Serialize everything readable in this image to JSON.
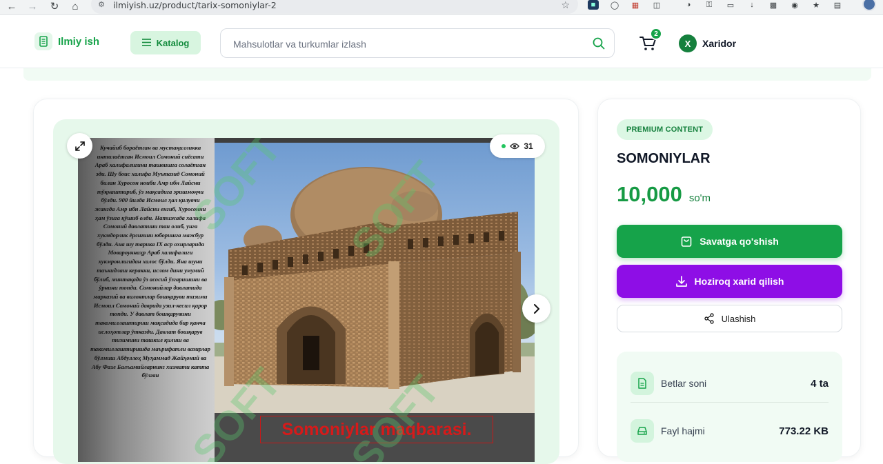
{
  "browser": {
    "url": "ilmiyish.uz/product/tarix-somoniylar-2"
  },
  "header": {
    "logo_text": "Ilmiy ish",
    "catalog_label": "Katalog",
    "search_placeholder": "Mahsulotlar va turkumlar izlash",
    "cart_count": "2",
    "user_initial": "X",
    "user_name": "Xaridor"
  },
  "gallery": {
    "views": "31",
    "caption": "Somoniylar maqbarasi.",
    "watermark": "SOFT",
    "slide_text": "Кучайиб бораётган ва мустақилликка интилаётган Исмоил Сомоний сиёсати Араб халифалигини ташвишга солаётган эди. Шу боис халифа Муътазид Сомоний билан Хуросон ноиби Амр ибн Лайсни тўқнаштириб, ўз мақсадига эришмоқчи бўлди. 900 йилда Исмоил ҳал қилувчи жангда Амр ибн Лайсни енгиб, Хуросонни ҳам ўзига қўшиб олди. Натижада халифа Сомоний давлатини тан олиб, унга хукмдорлик ёрлиғини юборишга мажбур бўлди. Ана шу тарика IX аср охирларида Мовароуннаҳр Араб халифалиги хукмронлигидан халос бўлди. Яна шуни таъкидлаш керакки, ислом дини умумий бўлиб, минтақада ўз асосий ўзгаришини ва ўрнини топди. Сомонийлар давлатида марказий ва вилоятлар бошқаруви тизими Исмоил Сомоний даврида узил-кесил қарор топди. У давлат бошқарувини такомиллаштириш мақсадида бир қанча ислоҳотлар ўтказди. Давлат бошқарув тизимини ташкил қилиш ва такомиллаштиришда маърифатли вазирлар бўлмиш Абдуллоҳ Муҳаммад Жайҳоний ва Абу Фазл Балъамийларнинг хизмати катта бўлган"
  },
  "product": {
    "badge": "PREMIUM CONTENT",
    "title": "SOMONIYLAR",
    "price": "10,000",
    "currency": "so'm",
    "add_to_cart": "Savatga qo'shish",
    "buy_now": "Hoziroq xarid qilish",
    "share": "Ulashish",
    "pages_label": "Betlar soni",
    "pages_value": "4 ta",
    "size_label": "Fayl hajmi",
    "size_value": "773.22 KB"
  },
  "colors": {
    "primary_green": "#16a34a",
    "buy_purple": "#8e0ee6",
    "caption_red": "#d61a1a"
  }
}
